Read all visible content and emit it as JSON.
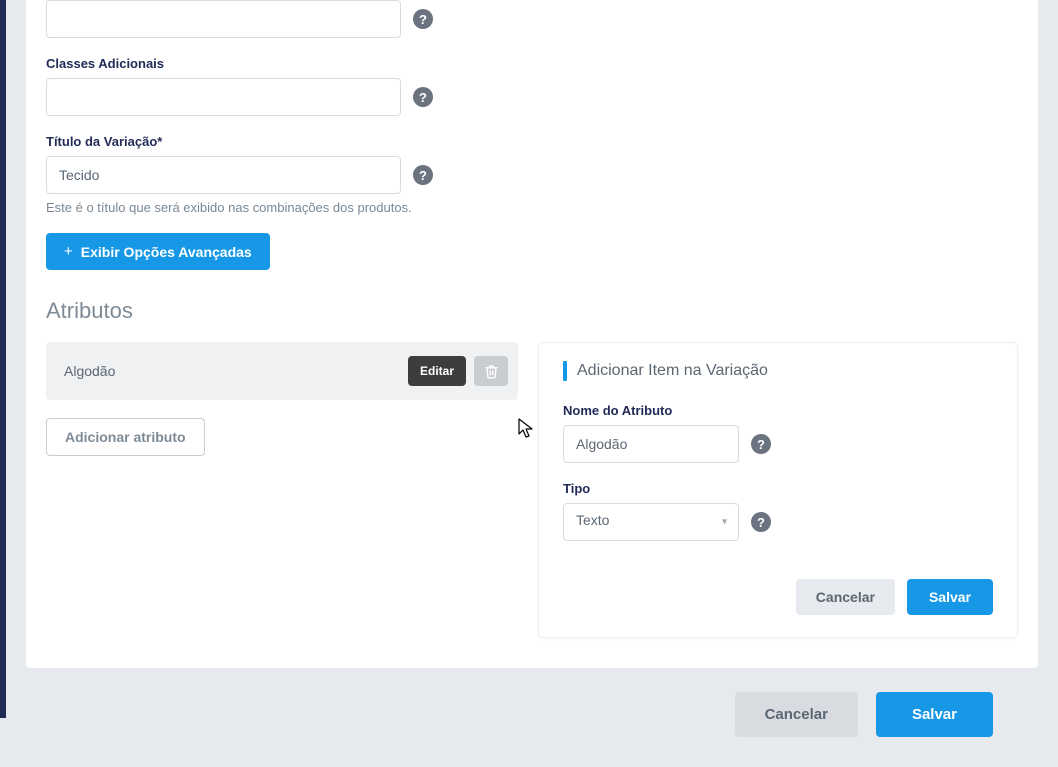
{
  "form": {
    "classes_label": "Classes Adicionais",
    "classes_value": "",
    "titulo_label": "Título da Variação*",
    "titulo_value": "Tecido",
    "titulo_help": "Este é o título que será exibido nas combinações dos produtos.",
    "advanced_btn": "Exibir Opções Avançadas"
  },
  "attributes": {
    "section_title": "Atributos",
    "items": [
      {
        "name": "Algodão",
        "edit_label": "Editar"
      }
    ],
    "add_attr_btn": "Adicionar atributo"
  },
  "panel": {
    "title": "Adicionar Item na Variação",
    "name_label": "Nome do Atributo",
    "name_value": "Algodão",
    "type_label": "Tipo",
    "type_value": "Texto",
    "cancel": "Cancelar",
    "save": "Salvar"
  },
  "footer": {
    "cancel": "Cancelar",
    "save": "Salvar"
  },
  "icons": {
    "help": "?"
  }
}
